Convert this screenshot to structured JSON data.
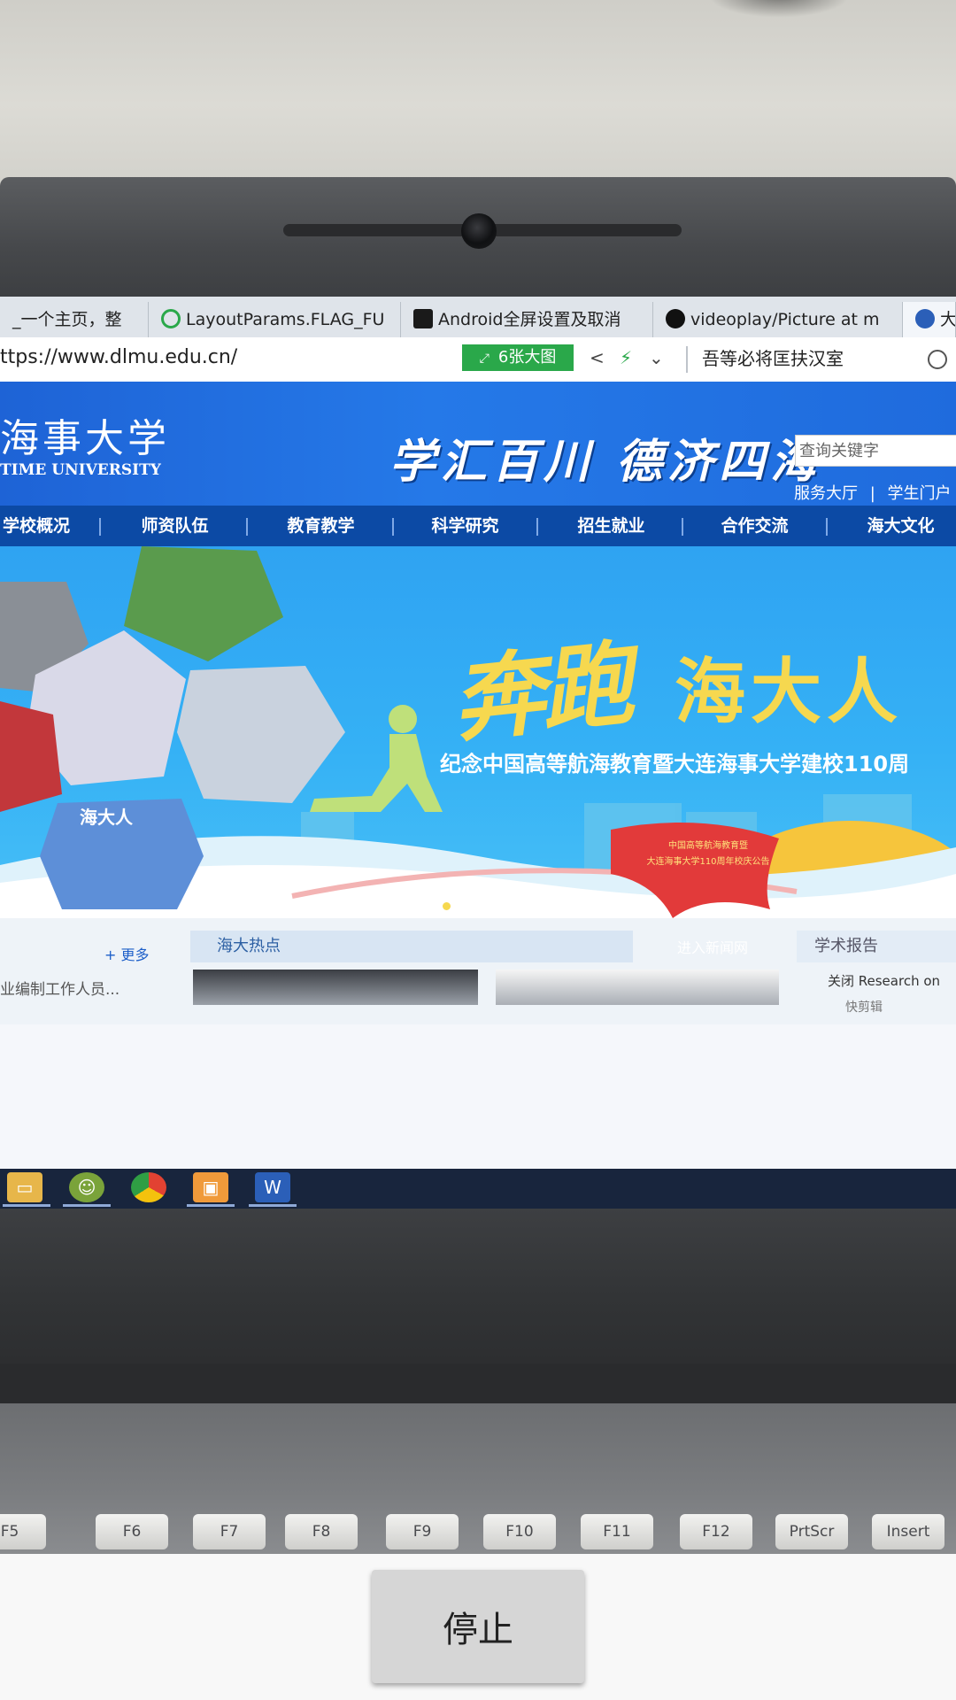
{
  "browser": {
    "tabs": [
      {
        "title": "_一个主页，整"
      },
      {
        "title": "LayoutParams.FLAG_FU"
      },
      {
        "title": "Android全屏设置及取消"
      },
      {
        "title": "videoplay/Picture at m"
      },
      {
        "title": "大"
      }
    ],
    "url": "ttps://www.dlmu.edu.cn/",
    "big_image_label": "6张大图",
    "search_text": "吾等必将匡扶汉室"
  },
  "site": {
    "logo_cn": "海事大学",
    "logo_en": "TIME UNIVERSITY",
    "motto": "学汇百川 德济四海",
    "search_placeholder": "查询关键字",
    "links": [
      "服务大厅",
      "|",
      "学生门户"
    ],
    "nav": [
      "学校概况",
      "师资队伍",
      "教育教学",
      "科学研究",
      "招生就业",
      "合作交流",
      "海大文化"
    ]
  },
  "banner": {
    "title_script": "奔跑",
    "title_main": "海大人",
    "subtitle": "纪念中国高等航海教育暨大连海事大学建校110周",
    "photo_caption": "海大人",
    "flag_lines": [
      "中国高等航海教育暨",
      "大连海事大学110周年校庆公告"
    ],
    "dots": 6,
    "active_dot": 3
  },
  "content": {
    "more": "+ 更多",
    "hot_tab": "海大热点",
    "news_snippet": "业编制工作人员...",
    "news_link": "进入新闻网",
    "report_tab": "学术报告",
    "report_item": "关闭 Research on",
    "quick": "快剪辑"
  },
  "taskbar": {
    "apps": [
      "file-explorer",
      "messenger",
      "chrome",
      "tools",
      "word"
    ]
  },
  "phone": {
    "stop_label": "停止"
  },
  "keyboard": {
    "keys": [
      "F5",
      "F6",
      "F7",
      "F8",
      "F9",
      "F10",
      "F11",
      "F12",
      "PrtScr",
      "Insert"
    ]
  }
}
